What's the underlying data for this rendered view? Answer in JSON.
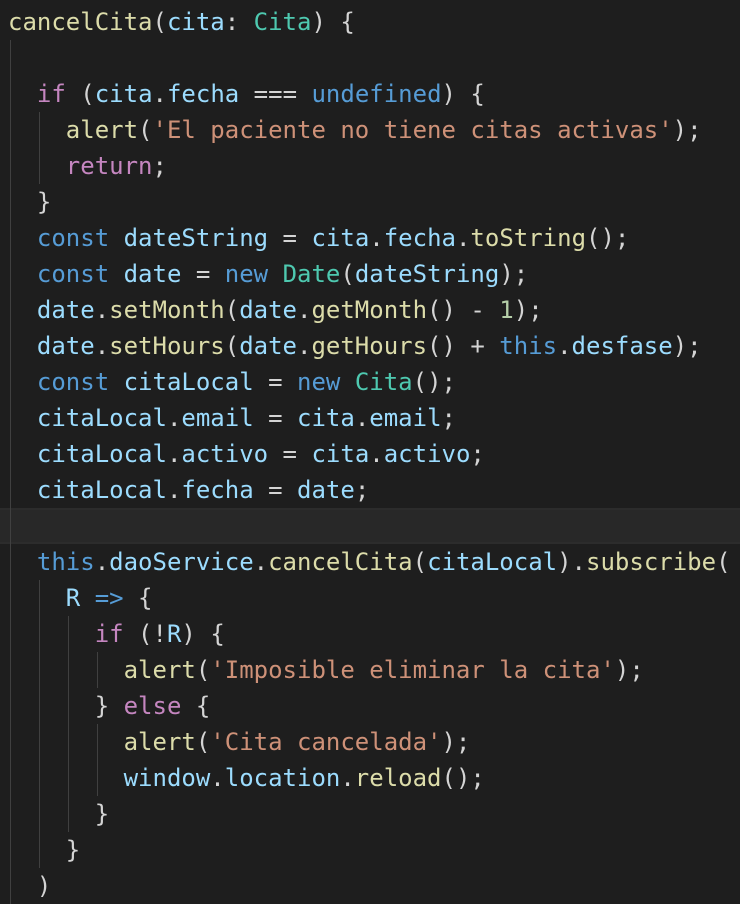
{
  "theme": {
    "background": "#1e1e1e",
    "colors": {
      "kw": "#569cd6",
      "ctl": "#c586c0",
      "fn": "#dcdcaa",
      "var": "#9cdcfe",
      "type": "#4ec9b0",
      "str": "#ce9178",
      "num": "#b5cea8",
      "pun": "#d4d4d4"
    }
  },
  "code": {
    "lines": [
      [
        [
          "fn",
          "cancelCita"
        ],
        [
          "pun",
          "("
        ],
        [
          "var",
          "cita"
        ],
        [
          "pun",
          ": "
        ],
        [
          "type",
          "Cita"
        ],
        [
          "pun",
          ") {"
        ]
      ],
      [],
      [
        [
          "pun",
          "  "
        ],
        [
          "ctl",
          "if"
        ],
        [
          "pun",
          " ("
        ],
        [
          "var",
          "cita"
        ],
        [
          "pun",
          "."
        ],
        [
          "var",
          "fecha"
        ],
        [
          "pun",
          " === "
        ],
        [
          "kw",
          "undefined"
        ],
        [
          "pun",
          ") {"
        ]
      ],
      [
        [
          "pun",
          "    "
        ],
        [
          "fn",
          "alert"
        ],
        [
          "pun",
          "("
        ],
        [
          "str",
          "'El paciente no tiene citas activas'"
        ],
        [
          "pun",
          ");"
        ]
      ],
      [
        [
          "pun",
          "    "
        ],
        [
          "ctl",
          "return"
        ],
        [
          "pun",
          ";"
        ]
      ],
      [
        [
          "pun",
          "  }"
        ]
      ],
      [
        [
          "pun",
          "  "
        ],
        [
          "kw",
          "const"
        ],
        [
          "pun",
          " "
        ],
        [
          "var",
          "dateString"
        ],
        [
          "pun",
          " = "
        ],
        [
          "var",
          "cita"
        ],
        [
          "pun",
          "."
        ],
        [
          "var",
          "fecha"
        ],
        [
          "pun",
          "."
        ],
        [
          "fn",
          "toString"
        ],
        [
          "pun",
          "();"
        ]
      ],
      [
        [
          "pun",
          "  "
        ],
        [
          "kw",
          "const"
        ],
        [
          "pun",
          " "
        ],
        [
          "var",
          "date"
        ],
        [
          "pun",
          " = "
        ],
        [
          "kw",
          "new"
        ],
        [
          "pun",
          " "
        ],
        [
          "type",
          "Date"
        ],
        [
          "pun",
          "("
        ],
        [
          "var",
          "dateString"
        ],
        [
          "pun",
          ");"
        ]
      ],
      [
        [
          "pun",
          "  "
        ],
        [
          "var",
          "date"
        ],
        [
          "pun",
          "."
        ],
        [
          "fn",
          "setMonth"
        ],
        [
          "pun",
          "("
        ],
        [
          "var",
          "date"
        ],
        [
          "pun",
          "."
        ],
        [
          "fn",
          "getMonth"
        ],
        [
          "pun",
          "() - "
        ],
        [
          "num",
          "1"
        ],
        [
          "pun",
          ");"
        ]
      ],
      [
        [
          "pun",
          "  "
        ],
        [
          "var",
          "date"
        ],
        [
          "pun",
          "."
        ],
        [
          "fn",
          "setHours"
        ],
        [
          "pun",
          "("
        ],
        [
          "var",
          "date"
        ],
        [
          "pun",
          "."
        ],
        [
          "fn",
          "getHours"
        ],
        [
          "pun",
          "() + "
        ],
        [
          "kw",
          "this"
        ],
        [
          "pun",
          "."
        ],
        [
          "var",
          "desfase"
        ],
        [
          "pun",
          ");"
        ]
      ],
      [
        [
          "pun",
          "  "
        ],
        [
          "kw",
          "const"
        ],
        [
          "pun",
          " "
        ],
        [
          "var",
          "citaLocal"
        ],
        [
          "pun",
          " = "
        ],
        [
          "kw",
          "new"
        ],
        [
          "pun",
          " "
        ],
        [
          "type",
          "Cita"
        ],
        [
          "pun",
          "();"
        ]
      ],
      [
        [
          "pun",
          "  "
        ],
        [
          "var",
          "citaLocal"
        ],
        [
          "pun",
          "."
        ],
        [
          "var",
          "email"
        ],
        [
          "pun",
          " = "
        ],
        [
          "var",
          "cita"
        ],
        [
          "pun",
          "."
        ],
        [
          "var",
          "email"
        ],
        [
          "pun",
          ";"
        ]
      ],
      [
        [
          "pun",
          "  "
        ],
        [
          "var",
          "citaLocal"
        ],
        [
          "pun",
          "."
        ],
        [
          "var",
          "activo"
        ],
        [
          "pun",
          " = "
        ],
        [
          "var",
          "cita"
        ],
        [
          "pun",
          "."
        ],
        [
          "var",
          "activo"
        ],
        [
          "pun",
          ";"
        ]
      ],
      [
        [
          "pun",
          "  "
        ],
        [
          "var",
          "citaLocal"
        ],
        [
          "pun",
          "."
        ],
        [
          "var",
          "fecha"
        ],
        [
          "pun",
          " = "
        ],
        [
          "var",
          "date"
        ],
        [
          "pun",
          ";"
        ]
      ],
      [],
      [
        [
          "pun",
          "  "
        ],
        [
          "kw",
          "this"
        ],
        [
          "pun",
          "."
        ],
        [
          "var",
          "daoService"
        ],
        [
          "pun",
          "."
        ],
        [
          "fn",
          "cancelCita"
        ],
        [
          "pun",
          "("
        ],
        [
          "var",
          "citaLocal"
        ],
        [
          "pun",
          ")."
        ],
        [
          "fn",
          "subscribe"
        ],
        [
          "pun",
          "("
        ]
      ],
      [
        [
          "pun",
          "    "
        ],
        [
          "var",
          "R"
        ],
        [
          "pun",
          " "
        ],
        [
          "kw",
          "=>"
        ],
        [
          "pun",
          " {"
        ]
      ],
      [
        [
          "pun",
          "      "
        ],
        [
          "ctl",
          "if"
        ],
        [
          "pun",
          " (!"
        ],
        [
          "var",
          "R"
        ],
        [
          "pun",
          ") {"
        ]
      ],
      [
        [
          "pun",
          "        "
        ],
        [
          "fn",
          "alert"
        ],
        [
          "pun",
          "("
        ],
        [
          "str",
          "'Imposible eliminar la cita'"
        ],
        [
          "pun",
          ");"
        ]
      ],
      [
        [
          "pun",
          "      } "
        ],
        [
          "ctl",
          "else"
        ],
        [
          "pun",
          " {"
        ]
      ],
      [
        [
          "pun",
          "        "
        ],
        [
          "fn",
          "alert"
        ],
        [
          "pun",
          "("
        ],
        [
          "str",
          "'Cita cancelada'"
        ],
        [
          "pun",
          ");"
        ]
      ],
      [
        [
          "pun",
          "        "
        ],
        [
          "var",
          "window"
        ],
        [
          "pun",
          "."
        ],
        [
          "var",
          "location"
        ],
        [
          "pun",
          "."
        ],
        [
          "fn",
          "reload"
        ],
        [
          "pun",
          "();"
        ]
      ],
      [
        [
          "pun",
          "      }"
        ]
      ],
      [
        [
          "pun",
          "    }"
        ]
      ],
      [
        [
          "pun",
          "  )"
        ]
      ]
    ]
  }
}
